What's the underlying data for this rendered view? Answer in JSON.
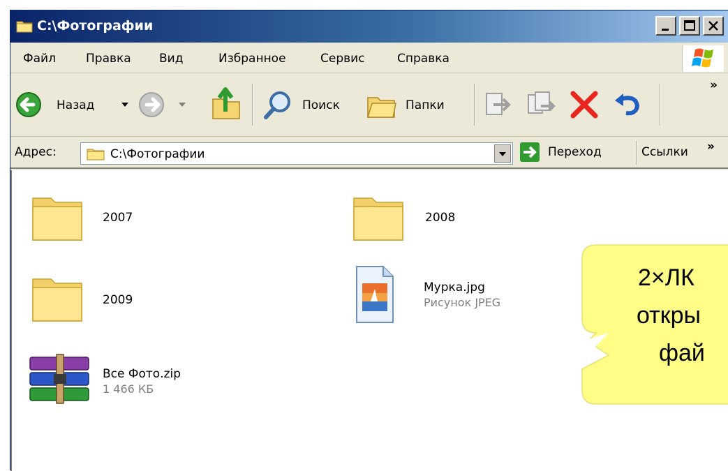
{
  "window": {
    "title": "C:\\Фотографии"
  },
  "menu": {
    "items": [
      "Файл",
      "Правка",
      "Вид",
      "Избранное",
      "Сервис",
      "Справка"
    ]
  },
  "toolbar": {
    "back_label": "Назад",
    "search_label": "Поиск",
    "folders_label": "Папки",
    "more_glyph": "»"
  },
  "address": {
    "label": "Адрес:",
    "value": "C:\\Фотографии",
    "go_label": "Переход",
    "links_label": "Ссылки",
    "links_more": "»"
  },
  "files": [
    {
      "name": "2007",
      "type": "folder"
    },
    {
      "name": "2008",
      "type": "folder"
    },
    {
      "name": "2009",
      "type": "folder"
    },
    {
      "name": "Мурка.jpg",
      "type": "image",
      "sub": "Рисунок JPEG"
    },
    {
      "name": "Все Фото.zip",
      "type": "archive",
      "sub": "1 466 КБ"
    }
  ],
  "callout": {
    "lines": [
      "2×ЛК",
      "откры",
      "фай"
    ],
    "color": "#ffff88"
  }
}
